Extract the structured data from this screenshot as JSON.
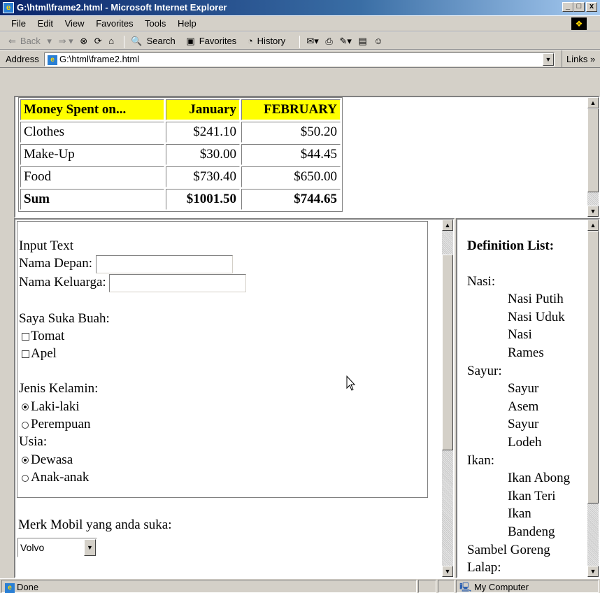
{
  "window": {
    "title": "G:\\html\\frame2.html - Microsoft Internet Explorer",
    "buttons": {
      "minimize": "_",
      "maximize": "□",
      "close": "x"
    }
  },
  "menu": [
    "File",
    "Edit",
    "View",
    "Favorites",
    "Tools",
    "Help"
  ],
  "toolbar": {
    "back": "Back",
    "search": "Search",
    "favorites": "Favorites",
    "history": "History"
  },
  "address": {
    "label": "Address",
    "value": "G:\\html\\frame2.html",
    "links": "Links"
  },
  "table": {
    "headers": [
      "Money Spent on...",
      "January",
      "FEBRUARY"
    ],
    "rows": [
      [
        "Clothes",
        "$241.10",
        "$50.20"
      ],
      [
        "Make-Up",
        "$30.00",
        "$44.45"
      ],
      [
        "Food",
        "$730.40",
        "$650.00"
      ],
      [
        "Sum",
        "$1001.50",
        "$744.65"
      ]
    ],
    "header_color": "#ffff00"
  },
  "form": {
    "heading": "Input Text",
    "first_name_label": "Nama Depan:",
    "first_name_value": "",
    "last_name_label": "Nama Keluarga:",
    "last_name_value": "",
    "fruit_label": "Saya Suka Buah:",
    "fruits": [
      "Tomat",
      "Apel"
    ],
    "gender_label": "Jenis Kelamin:",
    "genders": [
      "Laki-laki",
      "Perempuan"
    ],
    "gender_selected": "Laki-laki",
    "age_label": "Usia:",
    "ages": [
      "Dewasa",
      "Anak-anak"
    ],
    "age_selected": "Dewasa",
    "car_label": "Merk Mobil yang anda suka:",
    "car_selected": "Volvo"
  },
  "definition_list": {
    "title": "Definition List:",
    "groups": [
      {
        "term": "Nasi:",
        "items": [
          "Nasi Putih",
          "Nasi Uduk",
          "Nasi",
          "Rames"
        ]
      },
      {
        "term": "Sayur:",
        "items": [
          "Sayur",
          "Asem",
          "Sayur",
          "Lodeh"
        ]
      },
      {
        "term": "Ikan:",
        "items": [
          "Ikan Abong",
          "Ikan Teri",
          "Ikan",
          "Bandeng"
        ]
      }
    ],
    "tail": [
      "Sambel Goreng",
      "Lalap:"
    ]
  },
  "status": {
    "text": "Done",
    "zone": "My Computer"
  }
}
